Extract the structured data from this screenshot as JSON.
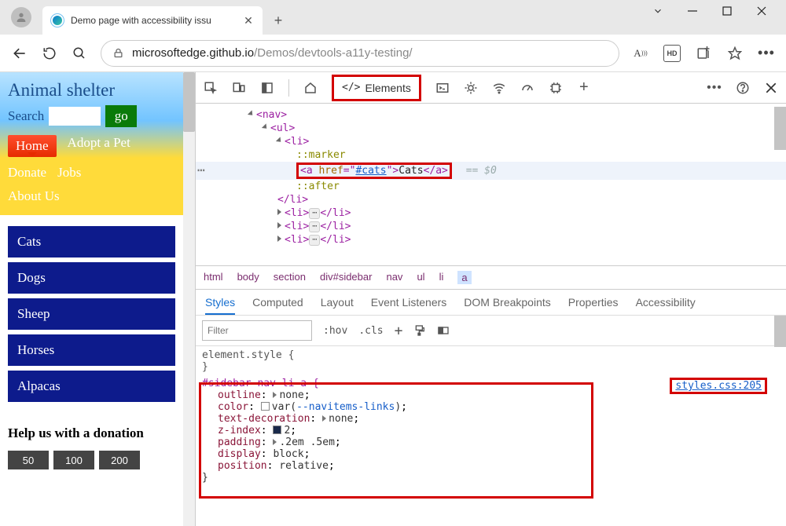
{
  "browser": {
    "tab_title": "Demo page with accessibility issu",
    "url_host": "microsoftedge.github.io",
    "url_path": "/Demos/devtools-a11y-testing/",
    "hd_badge": "HD"
  },
  "page": {
    "title": "Animal shelter",
    "search_label": "Search",
    "go_label": "go",
    "nav": [
      "Home",
      "Adopt a Pet",
      "Donate",
      "Jobs",
      "About Us"
    ],
    "sidebar": [
      "Cats",
      "Dogs",
      "Sheep",
      "Horses",
      "Alpacas"
    ],
    "donation_heading": "Help us with a donation",
    "donation_buttons": [
      "50",
      "100",
      "200"
    ]
  },
  "devtools": {
    "elements_label": "Elements",
    "dom": {
      "nav_open": "<nav>",
      "ul_open": "<ul>",
      "li_open": "<li>",
      "marker": "::marker",
      "a_open": "<a href=\"",
      "a_href": "#cats",
      "a_mid": "\">",
      "a_text": "Cats",
      "a_close": "</a>",
      "eq0": "== $0",
      "after": "::after",
      "li_close": "</li>",
      "li_collapsed_open": "<li>",
      "li_collapsed_close": "</li>"
    },
    "breadcrumb": [
      "html",
      "body",
      "section",
      "div#sidebar",
      "nav",
      "ul",
      "li",
      "a"
    ],
    "styles_tabs": [
      "Styles",
      "Computed",
      "Layout",
      "Event Listeners",
      "DOM Breakpoints",
      "Properties",
      "Accessibility"
    ],
    "filter_placeholder": "Filter",
    "hov": ":hov",
    "cls": ".cls",
    "element_style": "element.style {",
    "brace_close": "}",
    "rule_selector": "#sidebar nav li a {",
    "props": {
      "outline_n": "outline",
      "outline_v": "none",
      "color_n": "color",
      "color_v": "var(",
      "color_var": "--navitems-links",
      "color_end": ")",
      "textdec_n": "text-decoration",
      "textdec_v": "none",
      "zindex_n": "z-index",
      "zindex_v": "2",
      "padding_n": "padding",
      "padding_v": ".2em .5em",
      "display_n": "display",
      "display_v": "block",
      "position_n": "position",
      "position_v": "relative"
    },
    "source_link": "styles.css:205"
  }
}
